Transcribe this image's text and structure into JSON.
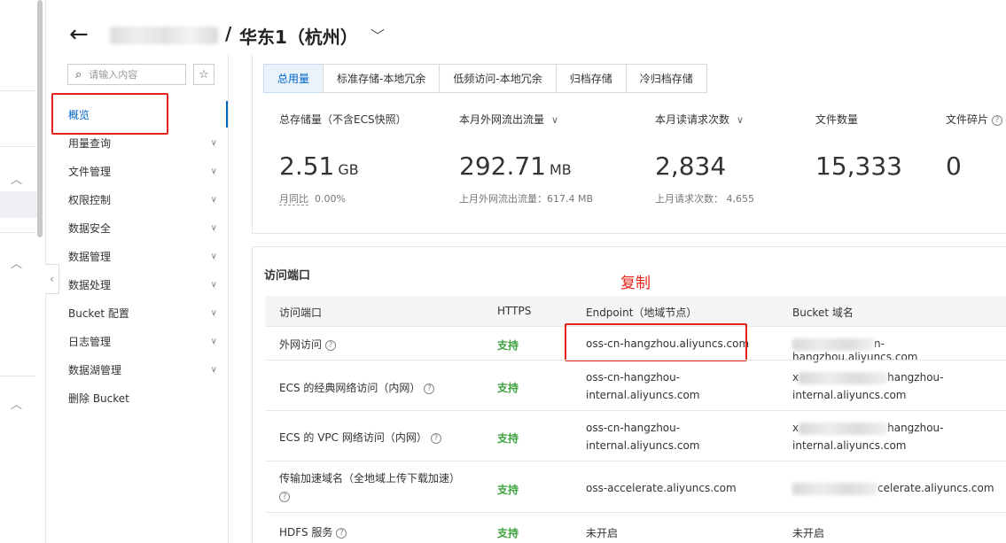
{
  "header": {
    "separator": "/",
    "region": "华东1（杭州）"
  },
  "search": {
    "placeholder": "请输入内容"
  },
  "menu": [
    {
      "label": "概览"
    },
    {
      "label": "用量查询"
    },
    {
      "label": "文件管理"
    },
    {
      "label": "权限控制"
    },
    {
      "label": "数据安全"
    },
    {
      "label": "数据管理"
    },
    {
      "label": "数据处理"
    },
    {
      "label": "Bucket 配置"
    },
    {
      "label": "日志管理"
    },
    {
      "label": "数据湖管理"
    },
    {
      "label": "删除 Bucket"
    }
  ],
  "tabs": [
    {
      "label": "总用量"
    },
    {
      "label": "标准存储-本地冗余"
    },
    {
      "label": "低频访问-本地冗余"
    },
    {
      "label": "归档存储"
    },
    {
      "label": "冷归档存储"
    }
  ],
  "stats": {
    "storage": {
      "label": "总存储量（不含ECS快照）",
      "value": "2.51",
      "unit": "GB",
      "sub_label": "月同比",
      "sub_value": "0.00%"
    },
    "traffic": {
      "label": "本月外网流出流量",
      "value": "292.71",
      "unit": "MB",
      "sub": "上月外网流出流量：617.4 MB"
    },
    "requests": {
      "label": "本月读请求次数",
      "value": "2,834",
      "sub": "上月请求次数： 4,655"
    },
    "files": {
      "label": "文件数量",
      "value": "15,333"
    },
    "fragments": {
      "label": "文件碎片",
      "value": "0"
    }
  },
  "endpoints": {
    "title": "访问端口",
    "annotation": "复制",
    "columns": [
      "访问端口",
      "HTTPS",
      "Endpoint（地域节点）",
      "Bucket 域名"
    ],
    "rows": [
      {
        "name": "外网访问",
        "https": "支持",
        "endpoint": "oss-cn-hangzhou.aliyuncs.com",
        "bucket": "n-hangzhou.aliyuncs.com"
      },
      {
        "name": "ECS 的经典网络访问（内网）",
        "https": "支持",
        "endpoint1": "oss-cn-hangzhou-",
        "endpoint2": "internal.aliyuncs.com",
        "bucket_pre": "x",
        "bucket1": "hangzhou-",
        "bucket2": "internal.aliyuncs.com"
      },
      {
        "name": "ECS 的 VPC 网络访问（内网）",
        "https": "支持",
        "endpoint1": "oss-cn-hangzhou-",
        "endpoint2": "internal.aliyuncs.com",
        "bucket_pre": "x",
        "bucket1": "hangzhou-",
        "bucket2": "internal.aliyuncs.com"
      },
      {
        "name": "传输加速域名（全地域上传下载加速）",
        "https": "支持",
        "endpoint": "oss-accelerate.aliyuncs.com",
        "bucket": "celerate.aliyuncs.com"
      },
      {
        "name": "HDFS 服务",
        "https": "支持",
        "endpoint": "未开启",
        "bucket": "未开启"
      }
    ]
  },
  "colors": {
    "accent": "#0064c8",
    "annotation_red": "#e5231a",
    "supported_green": "#3ea33e"
  }
}
